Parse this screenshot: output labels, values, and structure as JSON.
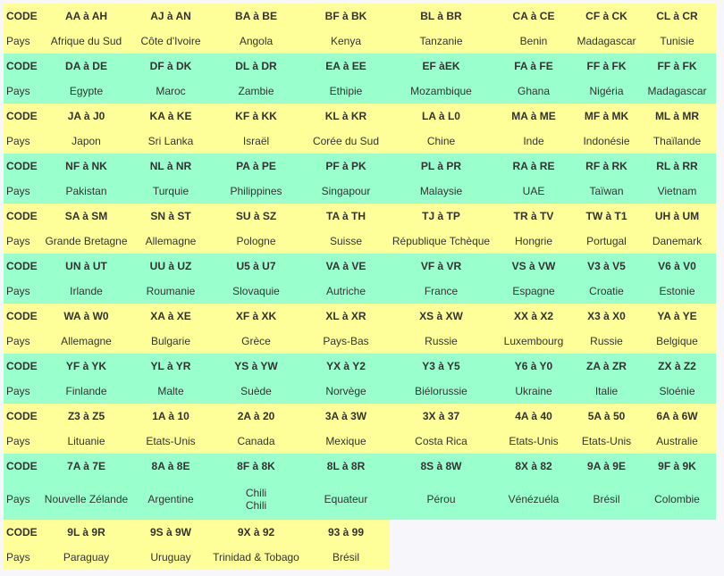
{
  "labels": {
    "code": "CODE",
    "country": "Pays"
  },
  "colors": {
    "yellow": "#ffff99",
    "green": "#99ffcc"
  },
  "groups": [
    {
      "codes": [
        "AA à AH",
        "AJ à AN",
        "BA à BE",
        "BF à BK",
        "BL à BR",
        "CA à CE",
        "CF à CK",
        "CL à CR"
      ],
      "countries": [
        "Afrique du Sud",
        "Côte d'Ivoire",
        "Angola",
        "Kenya",
        "Tanzanie",
        "Benin",
        "Madagascar",
        "Tunisie"
      ]
    },
    {
      "codes": [
        "DA à DE",
        "DF à DK",
        "DL à DR",
        "EA à EE",
        "EF àEK",
        "FA à FE",
        "FF à FK",
        "FF à FK"
      ],
      "countries": [
        "Egypte",
        "Maroc",
        "Zambie",
        "Ethipie",
        "Mozambique",
        "Ghana",
        "Nigéria",
        "Madagascar"
      ]
    },
    {
      "codes": [
        "JA à J0",
        "KA à KE",
        "KF à KK",
        "KL à KR",
        "LA à L0",
        "MA à ME",
        "MF à MK",
        "ML à MR"
      ],
      "countries": [
        "Japon",
        "Sri Lanka",
        "Israël",
        "Corée du Sud",
        "Chine",
        "Inde",
        "Indonésie",
        "Thaïlande"
      ]
    },
    {
      "codes": [
        "NF à NK",
        "NL à NR",
        "PA à PE",
        "PF à PK",
        "PL à PR",
        "RA à RE",
        "RF à RK",
        "RL à RR"
      ],
      "countries": [
        "Pakistan",
        "Turquie",
        "Philippines",
        "Singapour",
        "Malaysie",
        "UAE",
        "Taïwan",
        "Vietnam"
      ]
    },
    {
      "codes": [
        "SA à SM",
        "SN à ST",
        "SU à SZ",
        "TA à TH",
        "TJ à TP",
        "TR à TV",
        "TW à T1",
        "UH à UM"
      ],
      "countries": [
        "Grande Bretagne",
        "Allemagne",
        "Pologne",
        "Suisse",
        "République Tchèque",
        "Hongrie",
        "Portugal",
        "Danemark"
      ]
    },
    {
      "codes": [
        "UN à UT",
        "UU à UZ",
        "U5 à U7",
        "VA à VE",
        "VF à VR",
        "VS à VW",
        "V3 à V5",
        "V6 à V0"
      ],
      "countries": [
        "Irlande",
        "Roumanie",
        "Slovaquie",
        "Autriche",
        "France",
        "Espagne",
        "Croatie",
        "Estonie"
      ]
    },
    {
      "codes": [
        "WA à W0",
        "XA à XE",
        "XF à XK",
        "XL à XR",
        "XS à XW",
        "XX à X2",
        "X3 à X0",
        "YA à YE"
      ],
      "countries": [
        "Allemagne",
        "Bulgarie",
        "Grèce",
        "Pays-Bas",
        "Russie",
        "Luxembourg",
        "Russie",
        "Belgique"
      ]
    },
    {
      "codes": [
        "YF à YK",
        "YL à YR",
        "YS à YW",
        "YX à Y2",
        "Y3 à Y5",
        "Y6 à Y0",
        "ZA à ZR",
        "ZX à Z2"
      ],
      "countries": [
        "Finlande",
        "Malte",
        "Suède",
        "Norvège",
        "Biélorussie",
        "Ukraine",
        "Italie",
        "Sloénie"
      ]
    },
    {
      "codes": [
        "Z3 à Z5",
        "1A à 10",
        "2A à 20",
        "3A à 3W",
        "3X à 37",
        "4A à 40",
        "5A à 50",
        "6A à 6W"
      ],
      "countries": [
        "Lituanie",
        "Etats-Unis",
        "Canada",
        "Mexique",
        "Costa Rica",
        "Etats-Unis",
        "Etats-Unis",
        "Australie"
      ]
    },
    {
      "codes": [
        "7A à 7E",
        "8A à 8E",
        "8F à 8K",
        "8L à 8R",
        "8S à 8W",
        "8X à 82",
        "9A à 9E",
        "9F à 9K"
      ],
      "countries": [
        "Nouvelle Zélande",
        "Argentine",
        [
          "Chili",
          "Chili"
        ],
        "Equateur",
        "Pérou",
        "Vénézuéla",
        "Brésil",
        "Colombie"
      ]
    },
    {
      "codes": [
        "9L à 9R",
        "9S à 9W",
        "9X à 92",
        "93 à 99"
      ],
      "countries": [
        "Paraguay",
        "Uruguay",
        "Trinidad & Tobago",
        "Brésil"
      ]
    }
  ]
}
